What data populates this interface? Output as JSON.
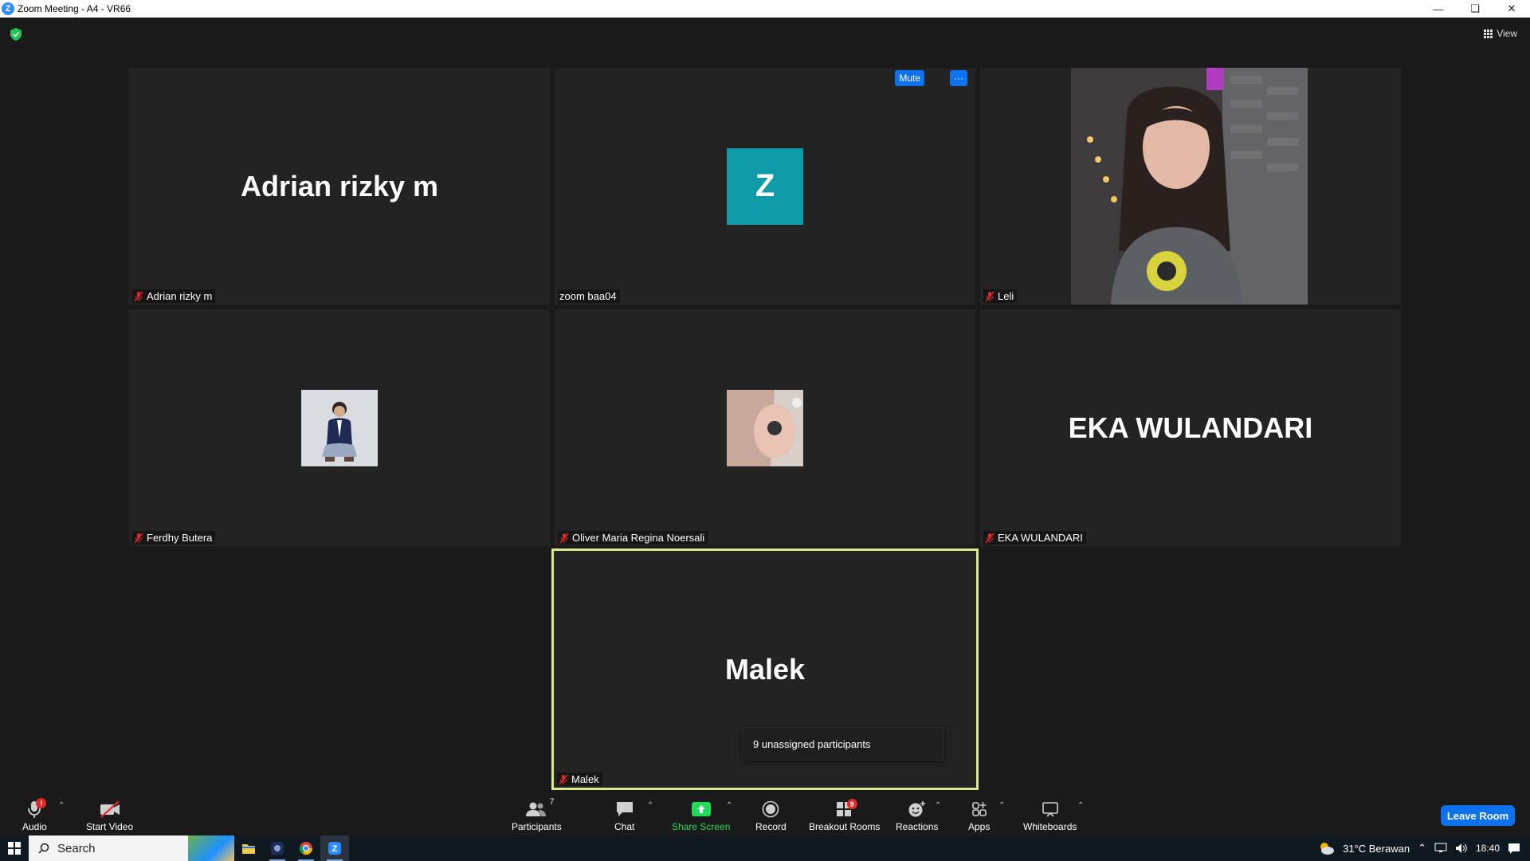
{
  "window": {
    "title": "Zoom Meeting - A4 - VR66",
    "controls": [
      "minimize-icon",
      "restore-icon",
      "close-icon"
    ]
  },
  "meeting": {
    "view_label": "View",
    "tiles": [
      {
        "name": "Adrian rizky m",
        "display": "Adrian rizky m",
        "type": "name",
        "muted": true
      },
      {
        "name": "zoom baa04",
        "avatar_letter": "Z",
        "type": "avatar",
        "avatar_color": "#0f9ba8",
        "muted": false
      },
      {
        "name": "Leli",
        "type": "video",
        "muted": true
      },
      {
        "name": "Ferdhy Butera",
        "type": "photo",
        "muted": true
      },
      {
        "name": "Oliver Maria Regina Noersali",
        "type": "photo",
        "muted": true
      },
      {
        "name": "EKA WULANDARI",
        "display": "EKA WULANDARI",
        "type": "name",
        "muted": true
      },
      {
        "name": "Malek",
        "display": "Malek",
        "type": "name",
        "muted": true,
        "active_speaker": true
      }
    ],
    "tile_actions": {
      "mute_label": "Mute",
      "more_label": "···"
    },
    "tooltip": "9 unassigned participants"
  },
  "toolbar": {
    "audio_label": "Audio",
    "video_label": "Start Video",
    "participants_label": "Participants",
    "participants_count": "7",
    "chat_label": "Chat",
    "share_label": "Share Screen",
    "record_label": "Record",
    "breakout_label": "Breakout Rooms",
    "breakout_badge": "9",
    "reactions_label": "Reactions",
    "apps_label": "Apps",
    "whiteboards_label": "Whiteboards",
    "leave_label": "Leave Room",
    "audio_badge": "!"
  },
  "taskbar": {
    "search_label": "Search",
    "weather": "31°C  Berawan",
    "time": "18:40"
  },
  "colors": {
    "accent": "#0e72ed",
    "share_green": "#23d959",
    "active_border": "#d9e98d",
    "muted_red": "#e02828"
  }
}
